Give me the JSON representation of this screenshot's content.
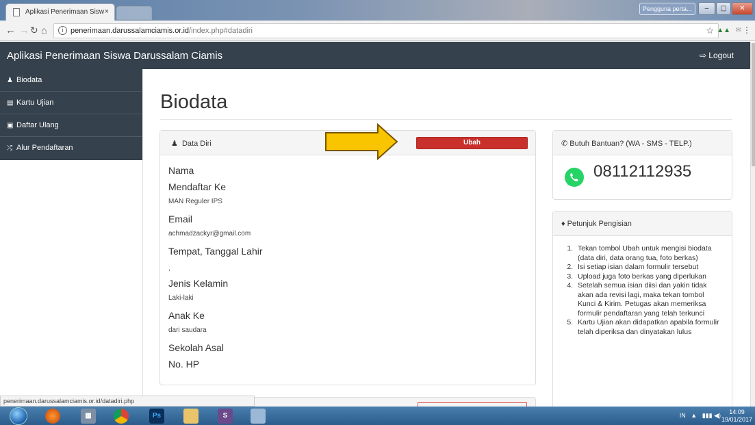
{
  "browser": {
    "tab_title": "Aplikasi Penerimaan Sisw",
    "tab_close": "×",
    "user_badge": "Pengguna perta...",
    "url_host": "penerimaan.darussalamciamis.or.id",
    "url_path": "/index.php#datadiri",
    "status_url": "penerimaan.darussalamciamis.or.id/datadiri.php"
  },
  "navbar": {
    "brand": "Aplikasi Penerimaan Siswa Darussalam Ciamis",
    "logout": "Logout"
  },
  "sidebar": {
    "items": [
      {
        "label": "Biodata",
        "icon": "user-icon"
      },
      {
        "label": "Kartu Ujian",
        "icon": "id-card-icon"
      },
      {
        "label": "Daftar Ulang",
        "icon": "card-icon"
      },
      {
        "label": "Alur Pendaftaran",
        "icon": "shuffle-icon"
      }
    ]
  },
  "page": {
    "title": "Biodata"
  },
  "data_diri": {
    "heading": "Data Diri",
    "button": "Ubah",
    "fields": [
      {
        "label": "Nama",
        "value": ""
      },
      {
        "label": "Mendaftar Ke",
        "value": "MAN Reguler IPS"
      },
      {
        "label": "Email",
        "value": "achmadzackyr@gmail.com"
      },
      {
        "label": "Tempat, Tanggal Lahir",
        "value": ","
      },
      {
        "label": "Jenis Kelamin",
        "value": "Laki-laki"
      },
      {
        "label": "Anak Ke",
        "value": "dari saudara"
      },
      {
        "label": "Sekolah Asal",
        "value": ""
      },
      {
        "label": "No. HP",
        "value": ""
      }
    ]
  },
  "help": {
    "heading": "Butuh Bantuan? (WA - SMS - TELP.)",
    "phone": "08112112935"
  },
  "petunjuk": {
    "heading": "Petunjuk Pengisian",
    "steps": [
      "Tekan tombol Ubah untuk mengisi biodata (data diri, data orang tua, foto berkas)",
      "Isi setiap isian dalam formulir tersebut",
      "Upload juga foto berkas yang diperlukan",
      "Setelah semua isian diisi dan yakin tidak akan ada revisi lagi, maka tekan tombol Kunci & Kirim. Petugas akan memeriksa formulir pendaftaran yang telah terkunci",
      "Kartu Ujian akan didapatkan apabila formulir telah diperiksa dan dinyatakan lulus"
    ]
  },
  "taskbar": {
    "tray_lang": "IN",
    "time": "14:09",
    "date": "19/01/2017"
  },
  "colors": {
    "navbar": "#35414d",
    "danger": "#c9302c",
    "arrow": "#f9c400"
  }
}
